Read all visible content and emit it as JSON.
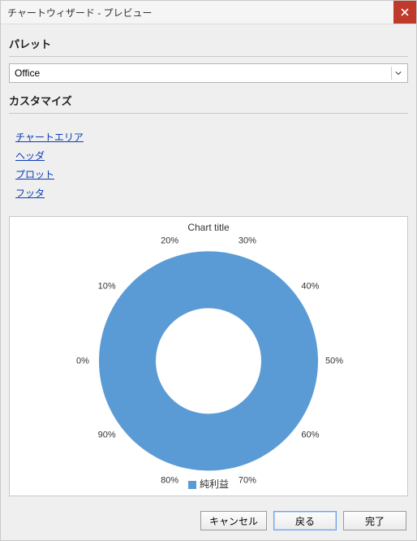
{
  "window": {
    "title": "チャートウィザード - プレビュー"
  },
  "sections": {
    "palette_title": "パレット",
    "customize_title": "カスタマイズ"
  },
  "palette": {
    "selected": "Office"
  },
  "customize_links": {
    "chart_area": "チャートエリア",
    "header": "ヘッダ",
    "plot": "プロット",
    "footer": "フッタ"
  },
  "buttons": {
    "cancel": "キャンセル",
    "back": "戻る",
    "finish": "完了"
  },
  "colors": {
    "series": "#5b9bd5"
  },
  "chart_data": {
    "type": "pie",
    "title": "Chart title",
    "series_name": "純利益",
    "labels": [
      "0%",
      "10%",
      "20%",
      "30%",
      "40%",
      "50%",
      "60%",
      "70%",
      "80%",
      "90%"
    ],
    "values": [
      10,
      10,
      10,
      10,
      10,
      10,
      10,
      10,
      10,
      10
    ],
    "donut": true
  }
}
